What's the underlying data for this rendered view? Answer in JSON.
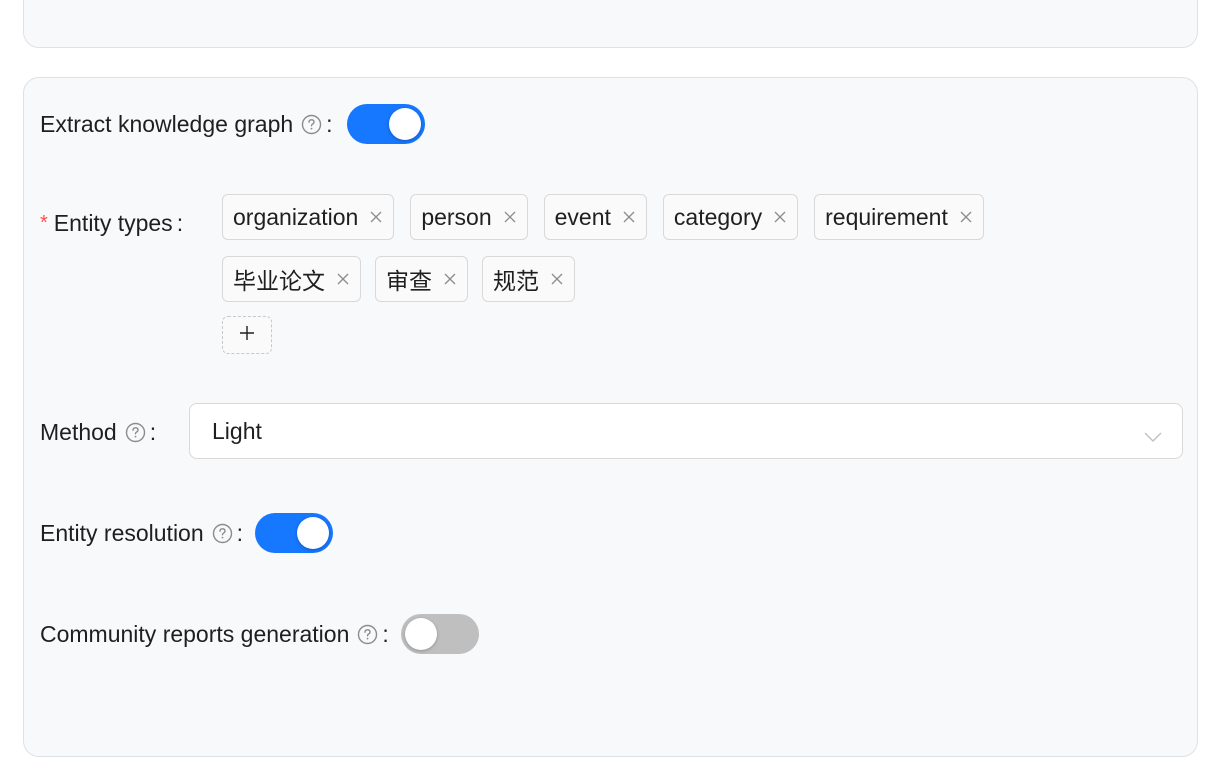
{
  "form": {
    "extract_kg": {
      "label": "Extract knowledge graph",
      "colon": ":",
      "enabled": true
    },
    "entity_types": {
      "label": "Entity types",
      "required_mark": "*",
      "colon": ":",
      "tags": [
        "organization",
        "person",
        "event",
        "category",
        "requirement",
        "毕业论文",
        "审查",
        "规范"
      ],
      "add_label": "+"
    },
    "method": {
      "label": "Method",
      "colon": ":",
      "value": "Light"
    },
    "entity_resolution": {
      "label": "Entity resolution",
      "colon": ":",
      "enabled": true
    },
    "community_reports": {
      "label": "Community reports generation",
      "colon": ":",
      "enabled": false
    }
  },
  "icons": {
    "help": "question-circle-icon",
    "tag_close": "close-icon",
    "select_arrow": "chevron-down-icon"
  },
  "colors": {
    "accent": "#1677ff",
    "toggle_off": "#bfbfbf",
    "required": "#ff4d4f",
    "card_bg": "#f8f9fa"
  }
}
